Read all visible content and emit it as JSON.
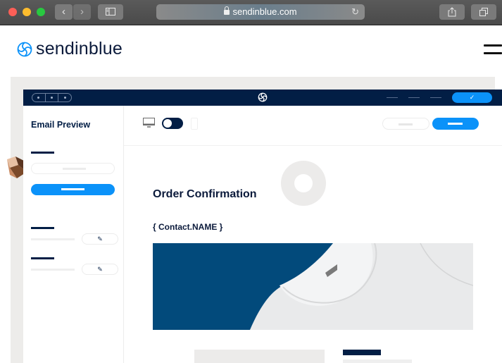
{
  "browser": {
    "url": "sendinblue.com",
    "back_icon": "chevron-left-icon",
    "forward_icon": "chevron-right-icon",
    "sidebar_icon": "sidebar-icon",
    "reload_icon": "reload-icon",
    "share_icon": "share-icon",
    "tabs_icon": "tabs-icon",
    "reload_glyph": "↻",
    "back_glyph": "‹",
    "forward_glyph": "›"
  },
  "site": {
    "brand": "sendinblue",
    "menu_icon": "hamburger-menu-icon",
    "brand_color": "#0b92f9",
    "navy": "#021e45"
  },
  "app": {
    "confirm_glyph": "✓",
    "sidebar": {
      "title": "Email Preview",
      "edit_glyph": "✎"
    },
    "email": {
      "title": "Order Confirmation",
      "subtitle": "{ Contact.NAME }"
    }
  }
}
